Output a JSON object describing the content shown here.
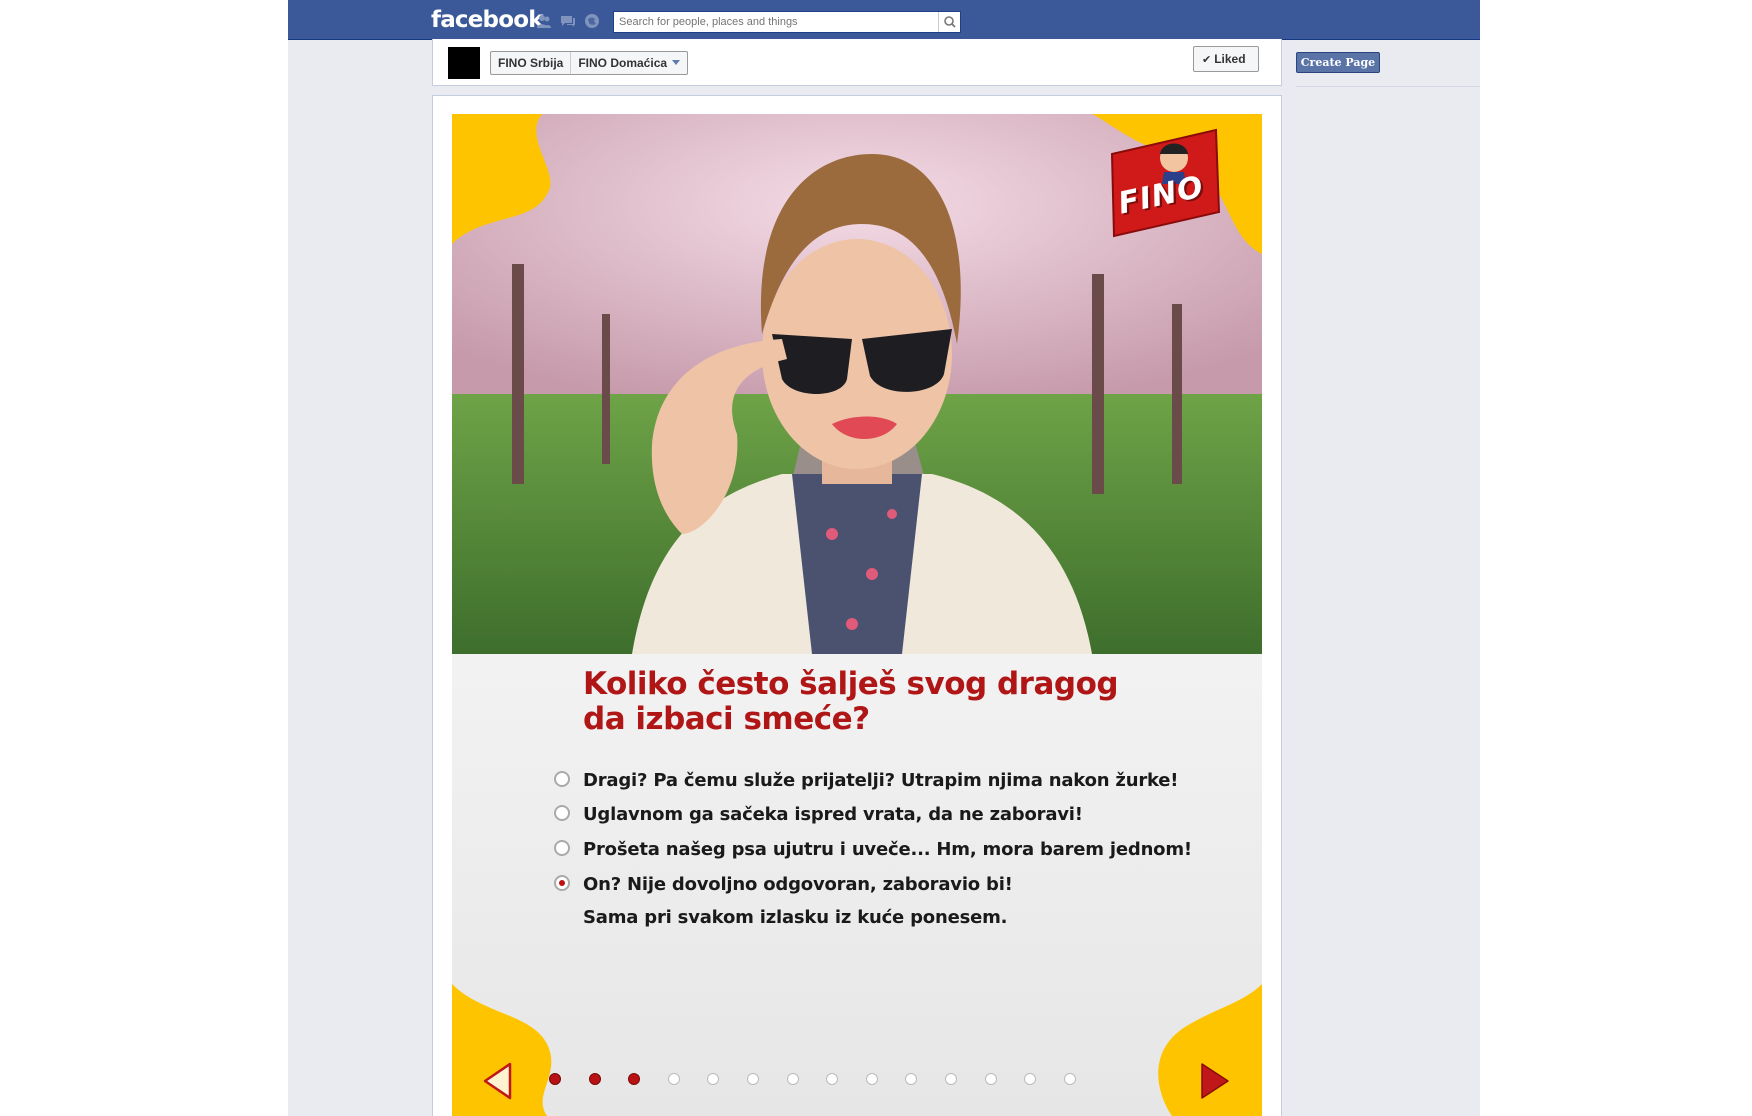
{
  "header": {
    "logo": "facebook",
    "search": {
      "placeholder": "Search for people, places and things"
    },
    "icons": [
      "friend-requests-icon",
      "messages-icon",
      "notifications-icon",
      "search-icon"
    ]
  },
  "page_bar": {
    "switcher_items": [
      "FINO Srbija",
      "FINO Domaćica"
    ],
    "liked_label": "Liked"
  },
  "right_column": {
    "create_page_label": "Create Page"
  },
  "app": {
    "brand": "FINO",
    "question": "Koliko često šalješ svog dragog da izbaci smeće?",
    "question_line1": "Koliko često šalješ svog dragog",
    "question_line2": "da izbaci smeće?",
    "options": [
      {
        "label": "Dragi? Pa čemu služe prijatelji? Utrapim njima nakon žurke!",
        "selected": false
      },
      {
        "label": "Uglavnom ga sačeka ispred vrata, da ne zaboravi!",
        "selected": false
      },
      {
        "label": "Prošeta našeg psa ujutru i uveče... Hm, mora barem jednom!",
        "selected": false
      },
      {
        "label": "On? Nije dovoljno odgovoran, zaboravio bi!",
        "extra_line": "Sama pri svakom izlasku iz kuće ponesem.",
        "selected": true
      }
    ],
    "pager": {
      "total": 14,
      "completed": 3
    },
    "colors": {
      "accent": "#b01616",
      "yellow": "#ffc400",
      "fb_blue": "#3b5998"
    }
  }
}
